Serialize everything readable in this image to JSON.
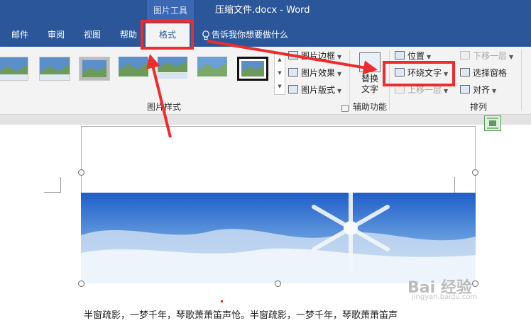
{
  "titlebar": {
    "tool_group": "图片工具",
    "document_title": "压缩文件.docx  -  Word"
  },
  "tabs": {
    "mail": "邮件",
    "review": "审阅",
    "view": "视图",
    "help": "帮助",
    "format": "格式",
    "tell_me": "告诉我你想要做什么"
  },
  "ribbon": {
    "picture_styles": {
      "label": "图片样式",
      "border": "图片边框",
      "effects": "图片效果",
      "layout": "图片版式"
    },
    "accessibility": {
      "label": "辅助功能",
      "alt_text_line1": "替换",
      "alt_text_line2": "文字"
    },
    "arrange": {
      "label": "排列",
      "position": "位置",
      "wrap_text": "环绕文字",
      "bring_forward": "上移一层",
      "send_backward": "下移一层",
      "selection_pane": "选择窗格",
      "align": "对齐"
    }
  },
  "document": {
    "body_text": "半窗疏影，一梦千年，琴歌萧萧笛声怆。半窗疏影，一梦千年，琴歌萧萧笛声"
  },
  "watermark": {
    "brand": "Bai 经验",
    "url": "jingyan.baidu.com"
  },
  "colors": {
    "word_blue": "#2b579a",
    "annotation_red": "#ee2c2c"
  }
}
